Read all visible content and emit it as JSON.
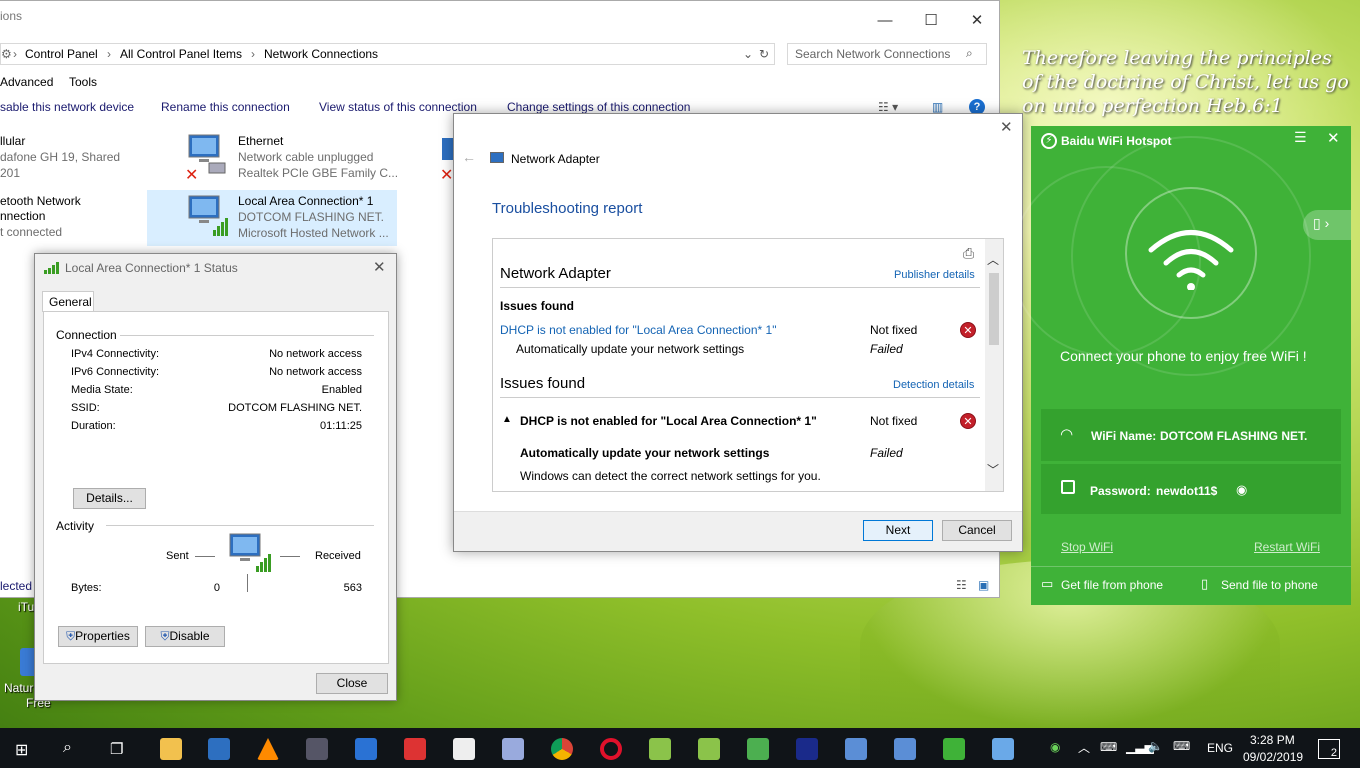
{
  "desktop": {
    "verse": "Therefore leaving the principles of the doctrine of Christ, let us go on unto perfection      Heb.6:1",
    "icon_labels": [
      "iTu",
      "Natur",
      "Free",
      "lected"
    ]
  },
  "explorer": {
    "title": "ions",
    "breadcrumb": [
      "Control Panel",
      "All Control Panel Items",
      "Network Connections"
    ],
    "search_placeholder": "Search Network Connections",
    "menu": [
      "Advanced",
      "Tools"
    ],
    "commands": [
      "sable this network device",
      "Rename this connection",
      "View status of this connection",
      "Change settings of this connection"
    ],
    "items": [
      {
        "name": "llular",
        "line1": "dafone GH  19, Shared",
        "line2": "201"
      },
      {
        "name": "Ethernet",
        "line1": "Network cable unplugged",
        "line2": "Realtek PCIe GBE Family C..."
      },
      {
        "name": "etooth Network",
        "line1": "nnection",
        "line2": "t connected"
      },
      {
        "name": "Local Area Connection* 1",
        "line1": "DOTCOM FLASHING NET.",
        "line2": "Microsoft Hosted Network ..."
      }
    ]
  },
  "status_dialog": {
    "title": "Local Area Connection* 1 Status",
    "tab": "General",
    "connection_heading": "Connection",
    "rows": [
      {
        "label": "IPv4 Connectivity:",
        "value": "No network access"
      },
      {
        "label": "IPv6 Connectivity:",
        "value": "No network access"
      },
      {
        "label": "Media State:",
        "value": "Enabled"
      },
      {
        "label": "SSID:",
        "value": "DOTCOM FLASHING NET."
      },
      {
        "label": "Duration:",
        "value": "01:11:25"
      }
    ],
    "details_button": "Details...",
    "activity_heading": "Activity",
    "sent_label": "Sent",
    "received_label": "Received",
    "bytes_label": "Bytes:",
    "bytes_sent": "0",
    "bytes_received": "563",
    "properties_button": "Properties",
    "disable_button": "Disable",
    "close_button": "Close"
  },
  "troubleshooter": {
    "header": "Network Adapter",
    "title": "Troubleshooting report",
    "section1_title": "Network Adapter",
    "publisher_link": "Publisher details",
    "issues_found_bold": "Issues found",
    "issue_link": "DHCP is not enabled for \"Local Area Connection* 1\"",
    "not_fixed": "Not fixed",
    "sub_item": "Automatically update your network settings",
    "failed": "Failed",
    "section2_title": "Issues found",
    "detection_link": "Detection details",
    "issue_bold": "DHCP is not enabled for \"Local Area Connection* 1\"",
    "not_fixed2": "Not fixed",
    "sub_bold": "Automatically update your network settings",
    "failed2": "Failed",
    "description": "Windows can detect the correct network settings for you.",
    "next_button": "Next",
    "cancel_button": "Cancel"
  },
  "baidu": {
    "title": "Baidu WiFi Hotspot",
    "connect_text": "Connect your phone to enjoy free WiFi !",
    "wifi_name_label": "WiFi Name:",
    "wifi_name": "DOTCOM FLASHING NET.",
    "password_label": "Password:",
    "password": "newdot11$",
    "stop": "Stop WiFi",
    "restart": "Restart WiFi",
    "get_file": "Get file from phone",
    "send_file": "Send file to phone"
  },
  "taskbar": {
    "language": "ENG",
    "time": "3:28 PM",
    "date": "09/02/2019",
    "notifications": "2"
  }
}
